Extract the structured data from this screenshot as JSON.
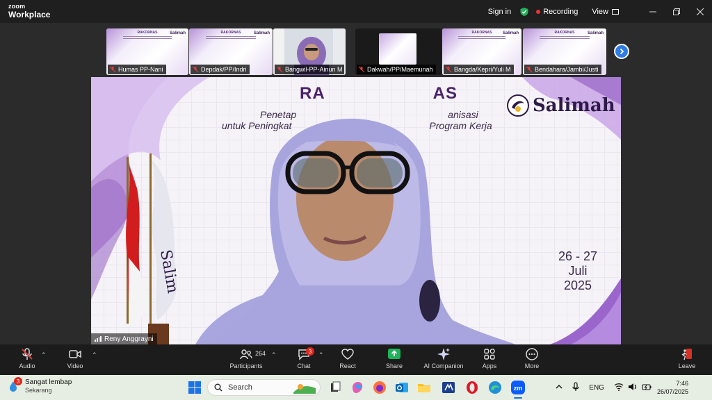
{
  "titlebar": {
    "brand_line1": "zoom",
    "brand_line2": "Workplace",
    "sign_in": "Sign in",
    "recording": "Recording",
    "view": "View"
  },
  "thumbnails": [
    {
      "name": "Humas PP-Nani",
      "type": "slide"
    },
    {
      "name": "Depdak/PP/Indri",
      "type": "slide"
    },
    {
      "name": "Bangwil-PP-Ainun M",
      "type": "video"
    },
    {
      "name": "Dakwah/PP/Maemunah",
      "type": "dark-slide"
    },
    {
      "name": "Bangda/Kepri/Yuli M",
      "type": "slide"
    },
    {
      "name": "Bendahara/Jambi/Justi",
      "type": "slide"
    }
  ],
  "thumb_slide": {
    "title": "RAKORNAS",
    "logo": "Salimah"
  },
  "main_video": {
    "title_left": "RA",
    "title_right": "AS",
    "subtitle1_left": "Penetap",
    "subtitle1_right": "anisasi",
    "subtitle2_left": "untuk Peningkat",
    "subtitle2_right": "Program Kerja",
    "logo_text": "Salimah",
    "date_days": "26 - 27",
    "date_month": "Juli",
    "date_year": "2025",
    "speaker": "Reny Anggrayni"
  },
  "toolbar": {
    "audio": "Audio",
    "video": "Video",
    "participants": "Participants",
    "participant_count": "264",
    "chat": "Chat",
    "chat_badge": "3",
    "react": "React",
    "share": "Share",
    "ai_companion": "AI Companion",
    "apps": "Apps",
    "more": "More",
    "leave": "Leave"
  },
  "taskbar": {
    "weather_title": "Sangat lembap",
    "weather_sub": "Sekarang",
    "weather_badge": "3",
    "search_placeholder": "Search",
    "language": "ENG",
    "time": "7:46",
    "date": "26/07/2025"
  },
  "colors": {
    "share_green": "#1fb35a",
    "accent_blue": "#2f7be8",
    "record_red": "#e33333",
    "slide_purple": "#4b2268"
  }
}
